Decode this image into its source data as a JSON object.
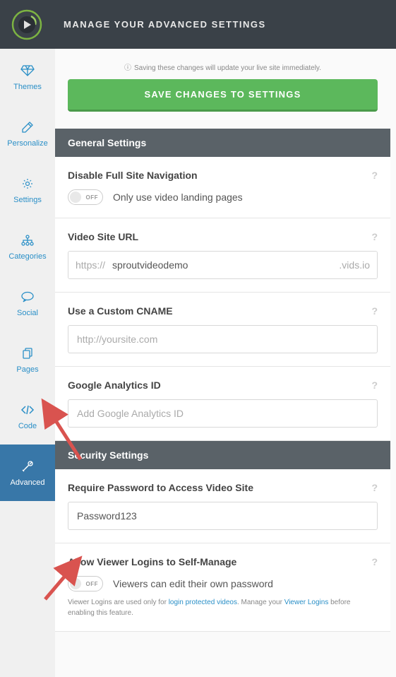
{
  "header": {
    "title": "MANAGE YOUR ADVANCED SETTINGS"
  },
  "sidebar": [
    {
      "label": "Themes"
    },
    {
      "label": "Personalize"
    },
    {
      "label": "Settings"
    },
    {
      "label": "Categories"
    },
    {
      "label": "Social"
    },
    {
      "label": "Pages"
    },
    {
      "label": "Code"
    },
    {
      "label": "Advanced"
    }
  ],
  "info_text": "Saving these changes will update your live site immediately.",
  "save_button": "SAVE CHANGES TO SETTINGS",
  "sections": {
    "general": {
      "title": "General Settings",
      "disable_nav": {
        "label": "Disable Full Site Navigation",
        "desc": "Only use video landing pages",
        "toggle": "OFF"
      },
      "video_url": {
        "label": "Video Site URL",
        "prefix": "https://",
        "value": "sproutvideodemo",
        "suffix": ".vids.io"
      },
      "cname": {
        "label": "Use a Custom CNAME",
        "placeholder": "http://yoursite.com"
      },
      "ga": {
        "label": "Google Analytics ID",
        "placeholder": "Add Google Analytics ID"
      }
    },
    "security": {
      "title": "Security Settings",
      "password": {
        "label": "Require Password to Access Video Site",
        "value": "Password123"
      },
      "self_manage": {
        "label": "Allow Viewer Logins to Self-Manage",
        "desc": "Viewers can edit their own password",
        "toggle": "OFF",
        "hint_pre": "Viewer Logins are used only for ",
        "hint_link1": "login protected videos",
        "hint_mid": ". Manage your ",
        "hint_link2": "Viewer Logins",
        "hint_post": " before enabling this feature."
      }
    }
  }
}
